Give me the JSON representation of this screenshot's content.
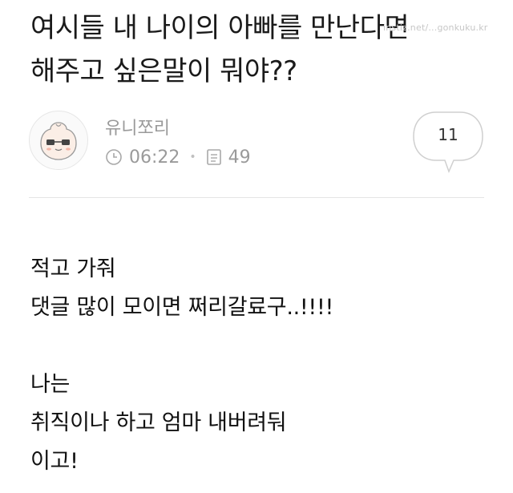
{
  "post": {
    "title_line1": "여시들 내 나이의 아빠를 만난다면",
    "title_line2": "해주고 싶은말이 뭐야??",
    "watermark": "instiz.net/...gonkuku.kr",
    "author": "유니쪼리",
    "time": "06:22",
    "views": "49",
    "comment_count": "11",
    "body_lines": [
      "적고 가줘",
      "댓글 많이 모이면 쩌리갈료구..!!!!",
      "",
      "나는",
      "취직이나 하고 엄마 내버려둬",
      "이고!"
    ]
  },
  "icons": {
    "clock": "clock-icon",
    "views": "document-icon",
    "comment": "speech-bubble-icon",
    "avatar": "peach-character-avatar"
  },
  "colors": {
    "meta_text": "#9a9a9a",
    "divider": "#e5e5e5",
    "title_text": "#1a1a1a"
  }
}
